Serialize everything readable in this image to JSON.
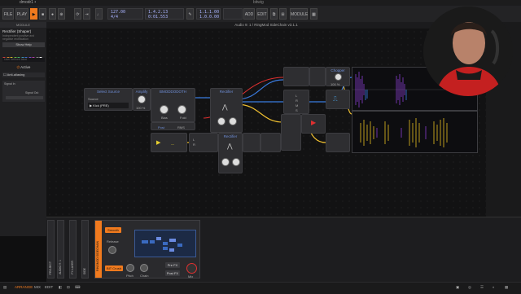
{
  "window": {
    "tab_title": "dmodr1 •",
    "logo": "bitwig"
  },
  "transport": {
    "file": "FILE",
    "play_menu": "PLAY",
    "tempo": "127.00",
    "signature": "4/4",
    "position_bars": "1.4.2.13",
    "position_time": "0:01.553",
    "loop_start": "1.1.1.00",
    "loop_end": "1.0.0.00",
    "add": "ADD",
    "edit": "EDIT",
    "module": "MODULE"
  },
  "inspector": {
    "header": "MODULE",
    "device_name": "Rectifier (Shaper)",
    "description": "Independent positive and negative rectification",
    "show_help": "Show Help",
    "swatch_colors": [
      "#e04040",
      "#e08a2a",
      "#d8c030",
      "#6cc040",
      "#40b870",
      "#40a0c0",
      "#4070e0",
      "#8050d0",
      "#c040b0",
      "#888888",
      "#ffffff"
    ],
    "placeholder": "User defined label",
    "active_label": "Active",
    "anti_alias": "Anti-aliasing",
    "signal_in": "Signal In",
    "signal_out": "Signal Out"
  },
  "canvas": {
    "title": "Audio 9: 1 / RingMod SideChain v3.1.1",
    "modules": {
      "select_source": {
        "title": "Select Source",
        "source_label": "Source",
        "source_value": "Kick (PRE)"
      },
      "amplify": {
        "title": "Amplify",
        "value": "100 %"
      },
      "bmodd": {
        "title": "BMODDODOTH",
        "bias": "Bias",
        "fold": "Fold"
      },
      "rectifier_top": {
        "title": "Rectifier"
      },
      "rectifier_bottom": {
        "title": "Rectifier"
      },
      "post": "Post",
      "rms": "RMS",
      "chopper": {
        "title": "Chopper",
        "value": "100 %"
      },
      "ring": {
        "l": "L",
        "r": "R",
        "m": "M",
        "s": "S"
      }
    }
  },
  "device_panel": {
    "tabs": [
      "PROJECT",
      "AUDIO 9: 1",
      "FX LAYER",
      "SIDE"
    ],
    "device_title": "RINGMOD SIDECHAIN",
    "smooth": "Smooth",
    "release": "Release",
    "sample": "BIT Crush",
    "pitch": "Pitch",
    "chain": "Chain",
    "pre_fx": "Pre FX",
    "post_fx": "Post FX",
    "mix": "Mix"
  },
  "footer": {
    "arrange": "ARRANGE",
    "mix": "MIX",
    "edit": "EDIT"
  }
}
